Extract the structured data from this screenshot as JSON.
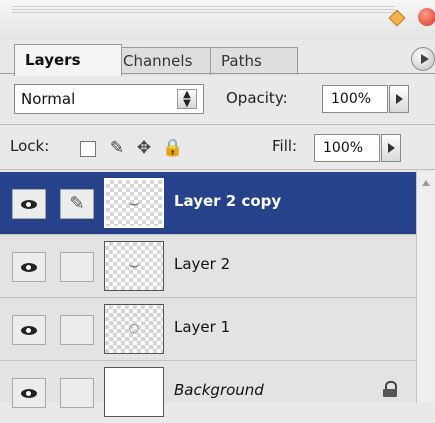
{
  "tabs": [
    {
      "label": "Layers",
      "active": true
    },
    {
      "label": "Channels",
      "active": false
    },
    {
      "label": "Paths",
      "active": false
    }
  ],
  "blend": {
    "mode": "Normal"
  },
  "opacity": {
    "label": "Opacity:",
    "value": "100%"
  },
  "lock": {
    "label": "Lock:"
  },
  "fill": {
    "label": "Fill:",
    "value": "100%"
  },
  "layers": [
    {
      "name": "Layer 2 copy",
      "selected": true
    },
    {
      "name": "Layer 2",
      "selected": false
    },
    {
      "name": "Layer 1",
      "selected": false
    },
    {
      "name": "Background",
      "selected": false,
      "locked": true
    }
  ],
  "colors": {
    "selection": "#26428b"
  }
}
